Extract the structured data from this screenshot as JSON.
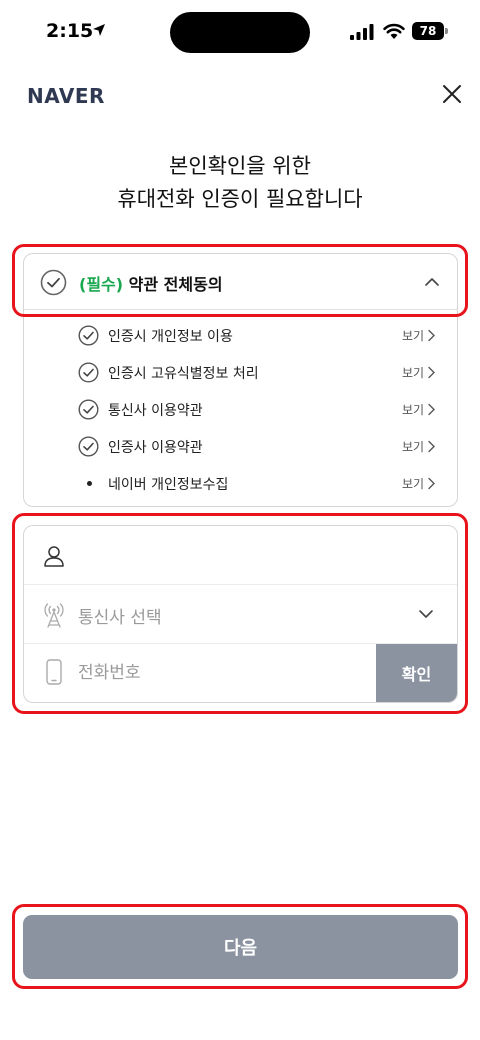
{
  "status_bar": {
    "time": "2:15",
    "battery": "78"
  },
  "header": {
    "logo": "NAVER"
  },
  "title": {
    "line1": "본인확인을 위한",
    "line2": "휴대전화 인증이 필요합니다"
  },
  "agreement": {
    "all_required": "(필수)",
    "all_label": "약관 전체동의",
    "items": [
      {
        "label": "인증시 개인정보 이용",
        "view": "보기",
        "type": "check"
      },
      {
        "label": "인증시 고유식별정보 처리",
        "view": "보기",
        "type": "check"
      },
      {
        "label": "통신사 이용약관",
        "view": "보기",
        "type": "check"
      },
      {
        "label": "인증사 이용약관",
        "view": "보기",
        "type": "check"
      },
      {
        "label": "네이버 개인정보수집",
        "view": "보기",
        "type": "bullet"
      }
    ]
  },
  "form": {
    "name_value": "",
    "carrier_placeholder": "통신사 선택",
    "phone_placeholder": "전화번호",
    "confirm_label": "확인"
  },
  "next_label": "다음",
  "colors": {
    "accent_green": "#19a84f",
    "button_gray": "#8b93a1",
    "highlight_red": "#e8141c",
    "logo_navy": "#2f3a52"
  },
  "icons": [
    "location-arrow-icon",
    "signal-icon",
    "wifi-icon",
    "close-icon",
    "check-circle-icon",
    "chevron-up-icon",
    "chevron-right-icon",
    "person-icon",
    "antenna-icon",
    "chevron-down-icon",
    "phone-icon"
  ]
}
